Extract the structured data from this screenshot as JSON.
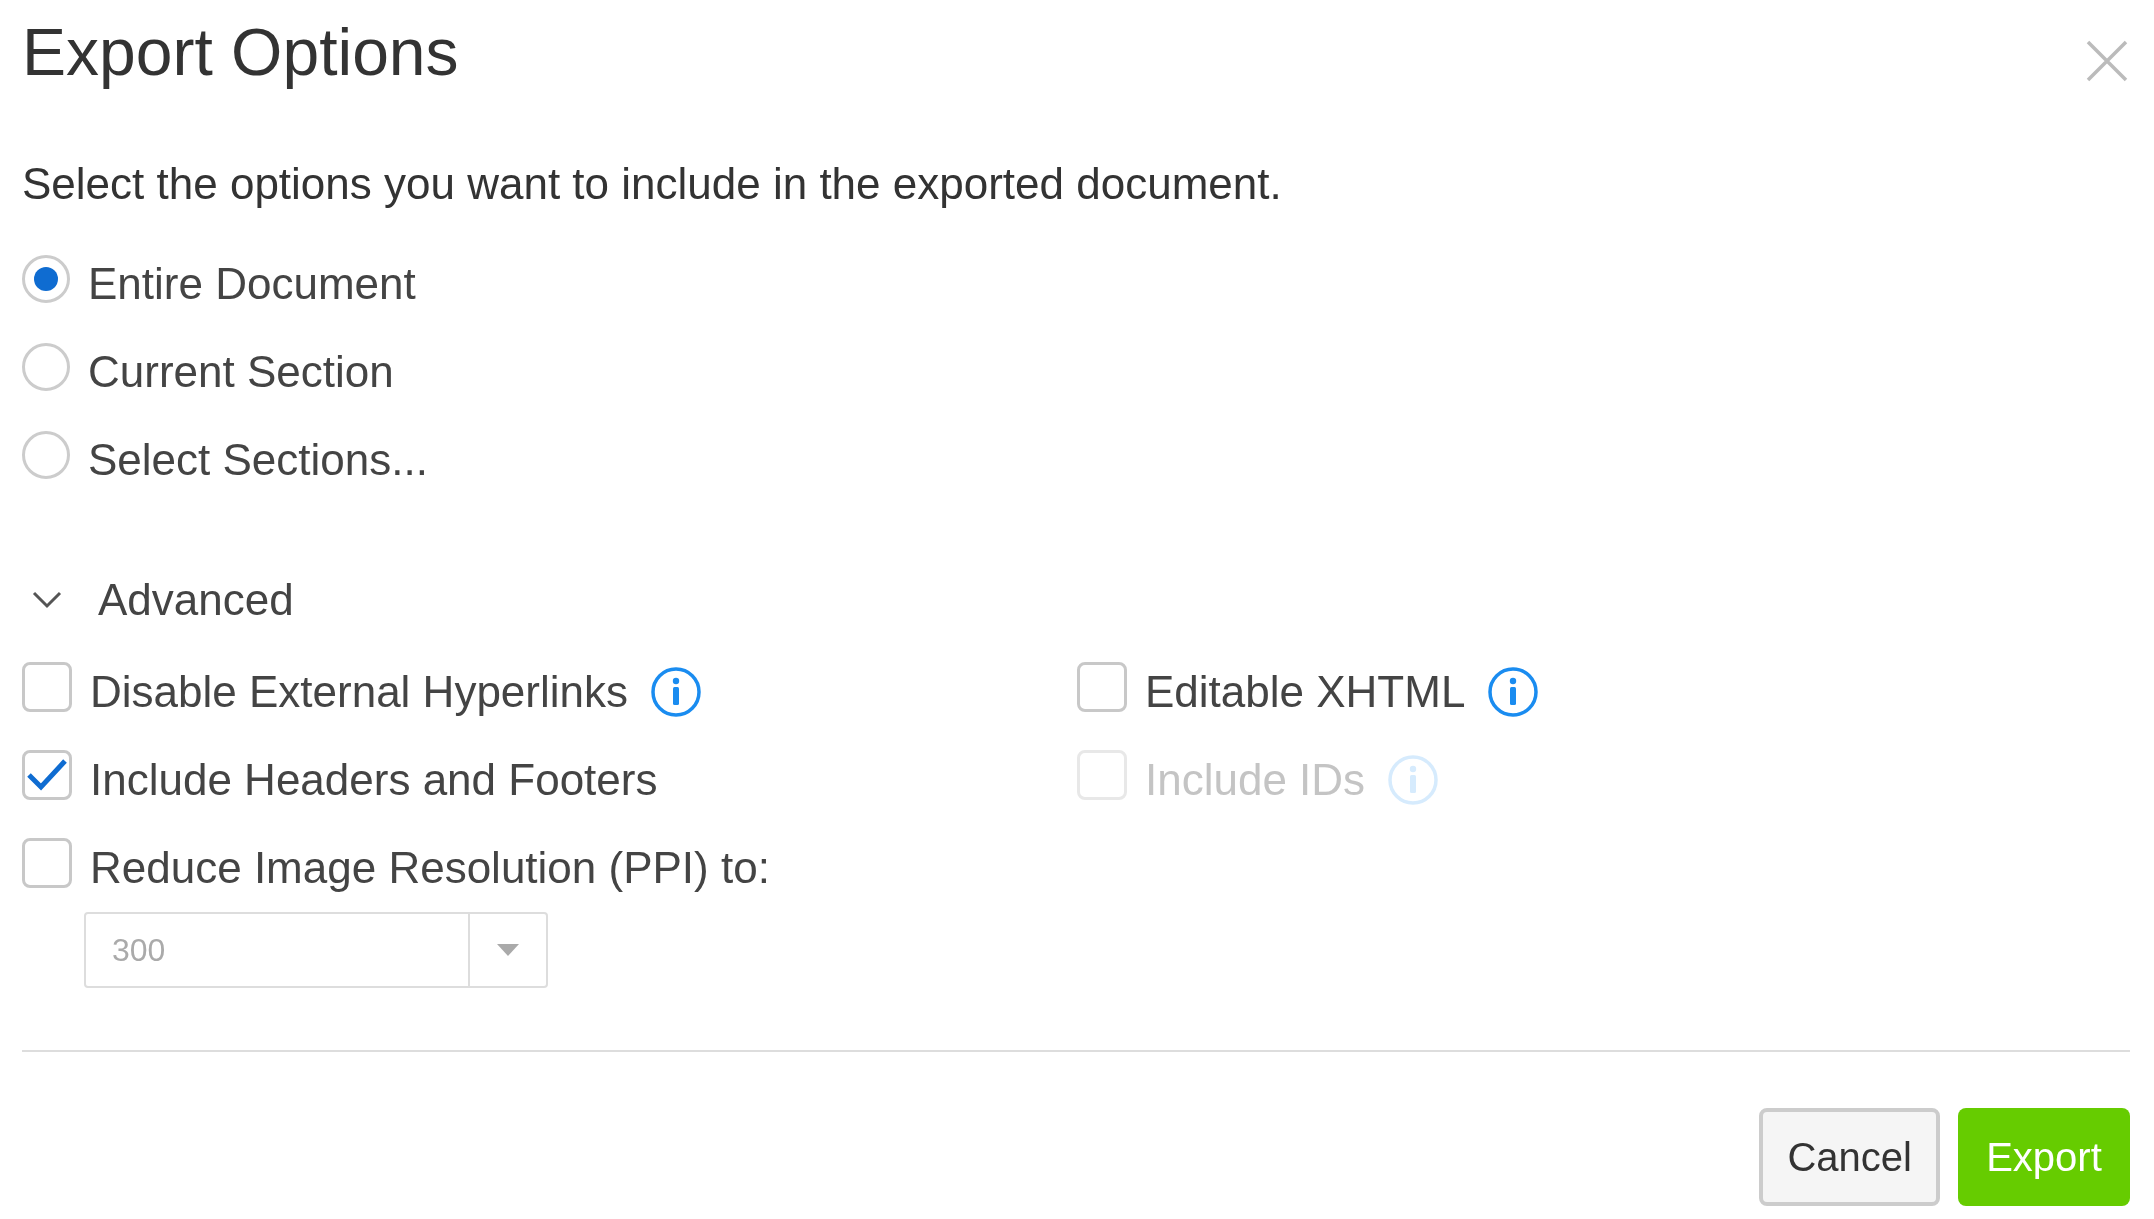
{
  "dialog": {
    "title": "Export Options"
  },
  "description": "Select the options you want to include in the exported document.",
  "scope_options": [
    {
      "label": "Entire Document",
      "selected": true
    },
    {
      "label": "Current Section",
      "selected": false
    },
    {
      "label": "Select Sections...",
      "selected": false
    }
  ],
  "advanced": {
    "label": "Advanced",
    "expanded": true,
    "left_options": [
      {
        "label": "Disable External Hyperlinks",
        "checked": false,
        "disabled": false,
        "info": true
      },
      {
        "label": "Include Headers and Footers",
        "checked": true,
        "disabled": false,
        "info": false
      },
      {
        "label": "Reduce Image Resolution (PPI) to:",
        "checked": false,
        "disabled": false,
        "info": false
      }
    ],
    "right_options": [
      {
        "label": "Editable XHTML",
        "checked": false,
        "disabled": false,
        "info": true
      },
      {
        "label": "Include IDs",
        "checked": false,
        "disabled": true,
        "info": true
      }
    ],
    "resolution": {
      "value": "300",
      "disabled": true
    }
  },
  "buttons": [
    {
      "label": "Cancel",
      "kind": "secondary"
    },
    {
      "label": "Export",
      "kind": "primary"
    }
  ]
}
